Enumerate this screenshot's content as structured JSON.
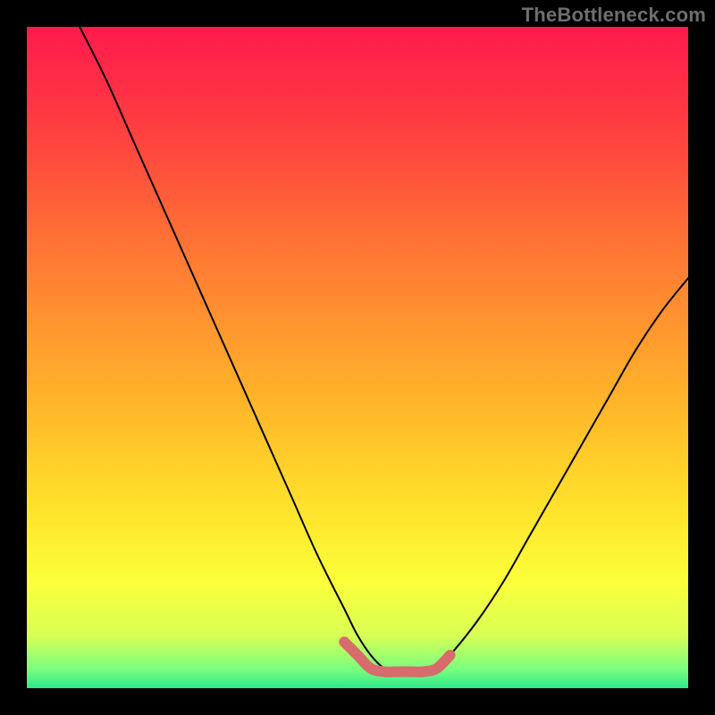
{
  "chart_data": {
    "type": "line",
    "title": "",
    "xlabel": "",
    "ylabel": "",
    "watermark": "TheBottleneck.com",
    "x_range": [
      0,
      100
    ],
    "y_range": [
      0,
      100
    ],
    "gradient_stops": [
      {
        "offset": 0,
        "color": "#ff1a4d"
      },
      {
        "offset": 16,
        "color": "#ff4040"
      },
      {
        "offset": 35,
        "color": "#ff7a33"
      },
      {
        "offset": 55,
        "color": "#ffb02a"
      },
      {
        "offset": 72,
        "color": "#ffe02a"
      },
      {
        "offset": 84,
        "color": "#fbff3a"
      },
      {
        "offset": 92,
        "color": "#d8ff55"
      },
      {
        "offset": 97,
        "color": "#7dff7d"
      },
      {
        "offset": 100,
        "color": "#2ee88a"
      }
    ],
    "series": [
      {
        "name": "bottleneck-curve",
        "color": "#000000",
        "x": [
          8,
          12,
          16,
          20,
          24,
          28,
          32,
          36,
          40,
          44,
          48,
          50,
          52,
          54,
          56,
          58,
          60,
          62,
          64,
          68,
          72,
          76,
          80,
          84,
          88,
          92,
          96,
          100
        ],
        "values": [
          100,
          92,
          83,
          74,
          65,
          56,
          47,
          38,
          29,
          20,
          12,
          8,
          5,
          3,
          2,
          2,
          2,
          3,
          5,
          10,
          16,
          23,
          30,
          37,
          44,
          51,
          57,
          62
        ]
      }
    ],
    "optimal_range": {
      "color": "#d86b6b",
      "x": [
        48,
        50,
        52,
        54,
        56,
        58,
        60,
        62,
        64
      ],
      "values": [
        7,
        5,
        3,
        2.5,
        2.5,
        2.5,
        2.5,
        3,
        5
      ]
    }
  }
}
